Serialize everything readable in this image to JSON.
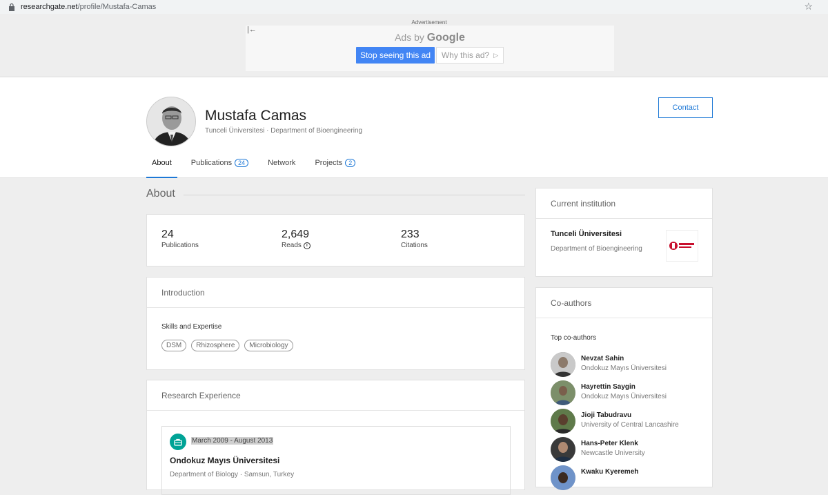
{
  "browser": {
    "url_domain": "researchgate.net",
    "url_path": "/profile/Mustafa-Camas"
  },
  "ad": {
    "label": "Advertisement",
    "ads_by": "Ads by",
    "google": "Google",
    "stop_button": "Stop seeing this ad",
    "why_button": "Why this ad?"
  },
  "profile": {
    "name": "Mustafa Camas",
    "affiliation": "Tunceli Üniversitesi · Department of Bioengineering",
    "contact_button": "Contact",
    "tabs": [
      {
        "label": "About",
        "badge": ""
      },
      {
        "label": "Publications",
        "badge": "24"
      },
      {
        "label": "Network",
        "badge": ""
      },
      {
        "label": "Projects",
        "badge": "2"
      }
    ]
  },
  "about": {
    "title": "About",
    "stats": [
      {
        "value": "24",
        "label": "Publications"
      },
      {
        "value": "2,649",
        "label": "Reads"
      },
      {
        "value": "233",
        "label": "Citations"
      }
    ],
    "introduction": {
      "title": "Introduction",
      "skills_title": "Skills and Expertise",
      "skills": [
        "DSM",
        "Rhizosphere",
        "Microbiology"
      ]
    },
    "research_experience": {
      "title": "Research Experience",
      "date": "March 2009 - August 2013",
      "institution": "Ondokuz Mayıs Üniversitesi",
      "department": "Department of Biology · Samsun, Turkey"
    }
  },
  "current_institution": {
    "title": "Current institution",
    "name": "Tunceli Üniversitesi",
    "department": "Department of Bioengineering"
  },
  "coauthors": {
    "title": "Co-authors",
    "top_label": "Top co-authors",
    "items": [
      {
        "name": "Nevzat Sahin",
        "affiliation": "Ondokuz Mayıs Üniversitesi"
      },
      {
        "name": "Hayrettin Saygin",
        "affiliation": "Ondokuz Mayıs Üniversitesi"
      },
      {
        "name": "Jioji Tabudravu",
        "affiliation": "University of Central Lancashire"
      },
      {
        "name": "Hans-Peter Klenk",
        "affiliation": "Newcastle University"
      },
      {
        "name": "Kwaku Kyeremeh",
        "affiliation": ""
      }
    ]
  }
}
